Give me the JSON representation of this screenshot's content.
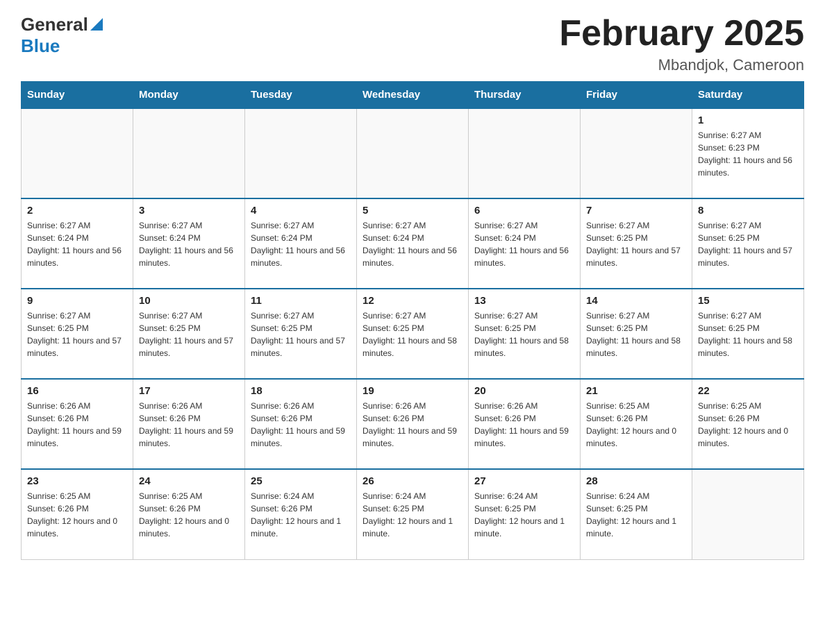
{
  "header": {
    "logo_general": "General",
    "logo_blue": "Blue",
    "month_title": "February 2025",
    "location": "Mbandjok, Cameroon"
  },
  "days_of_week": [
    "Sunday",
    "Monday",
    "Tuesday",
    "Wednesday",
    "Thursday",
    "Friday",
    "Saturday"
  ],
  "weeks": [
    [
      {
        "day": "",
        "sunrise": "",
        "sunset": "",
        "daylight": ""
      },
      {
        "day": "",
        "sunrise": "",
        "sunset": "",
        "daylight": ""
      },
      {
        "day": "",
        "sunrise": "",
        "sunset": "",
        "daylight": ""
      },
      {
        "day": "",
        "sunrise": "",
        "sunset": "",
        "daylight": ""
      },
      {
        "day": "",
        "sunrise": "",
        "sunset": "",
        "daylight": ""
      },
      {
        "day": "",
        "sunrise": "",
        "sunset": "",
        "daylight": ""
      },
      {
        "day": "1",
        "sunrise": "Sunrise: 6:27 AM",
        "sunset": "Sunset: 6:23 PM",
        "daylight": "Daylight: 11 hours and 56 minutes."
      }
    ],
    [
      {
        "day": "2",
        "sunrise": "Sunrise: 6:27 AM",
        "sunset": "Sunset: 6:24 PM",
        "daylight": "Daylight: 11 hours and 56 minutes."
      },
      {
        "day": "3",
        "sunrise": "Sunrise: 6:27 AM",
        "sunset": "Sunset: 6:24 PM",
        "daylight": "Daylight: 11 hours and 56 minutes."
      },
      {
        "day": "4",
        "sunrise": "Sunrise: 6:27 AM",
        "sunset": "Sunset: 6:24 PM",
        "daylight": "Daylight: 11 hours and 56 minutes."
      },
      {
        "day": "5",
        "sunrise": "Sunrise: 6:27 AM",
        "sunset": "Sunset: 6:24 PM",
        "daylight": "Daylight: 11 hours and 56 minutes."
      },
      {
        "day": "6",
        "sunrise": "Sunrise: 6:27 AM",
        "sunset": "Sunset: 6:24 PM",
        "daylight": "Daylight: 11 hours and 56 minutes."
      },
      {
        "day": "7",
        "sunrise": "Sunrise: 6:27 AM",
        "sunset": "Sunset: 6:25 PM",
        "daylight": "Daylight: 11 hours and 57 minutes."
      },
      {
        "day": "8",
        "sunrise": "Sunrise: 6:27 AM",
        "sunset": "Sunset: 6:25 PM",
        "daylight": "Daylight: 11 hours and 57 minutes."
      }
    ],
    [
      {
        "day": "9",
        "sunrise": "Sunrise: 6:27 AM",
        "sunset": "Sunset: 6:25 PM",
        "daylight": "Daylight: 11 hours and 57 minutes."
      },
      {
        "day": "10",
        "sunrise": "Sunrise: 6:27 AM",
        "sunset": "Sunset: 6:25 PM",
        "daylight": "Daylight: 11 hours and 57 minutes."
      },
      {
        "day": "11",
        "sunrise": "Sunrise: 6:27 AM",
        "sunset": "Sunset: 6:25 PM",
        "daylight": "Daylight: 11 hours and 57 minutes."
      },
      {
        "day": "12",
        "sunrise": "Sunrise: 6:27 AM",
        "sunset": "Sunset: 6:25 PM",
        "daylight": "Daylight: 11 hours and 58 minutes."
      },
      {
        "day": "13",
        "sunrise": "Sunrise: 6:27 AM",
        "sunset": "Sunset: 6:25 PM",
        "daylight": "Daylight: 11 hours and 58 minutes."
      },
      {
        "day": "14",
        "sunrise": "Sunrise: 6:27 AM",
        "sunset": "Sunset: 6:25 PM",
        "daylight": "Daylight: 11 hours and 58 minutes."
      },
      {
        "day": "15",
        "sunrise": "Sunrise: 6:27 AM",
        "sunset": "Sunset: 6:25 PM",
        "daylight": "Daylight: 11 hours and 58 minutes."
      }
    ],
    [
      {
        "day": "16",
        "sunrise": "Sunrise: 6:26 AM",
        "sunset": "Sunset: 6:26 PM",
        "daylight": "Daylight: 11 hours and 59 minutes."
      },
      {
        "day": "17",
        "sunrise": "Sunrise: 6:26 AM",
        "sunset": "Sunset: 6:26 PM",
        "daylight": "Daylight: 11 hours and 59 minutes."
      },
      {
        "day": "18",
        "sunrise": "Sunrise: 6:26 AM",
        "sunset": "Sunset: 6:26 PM",
        "daylight": "Daylight: 11 hours and 59 minutes."
      },
      {
        "day": "19",
        "sunrise": "Sunrise: 6:26 AM",
        "sunset": "Sunset: 6:26 PM",
        "daylight": "Daylight: 11 hours and 59 minutes."
      },
      {
        "day": "20",
        "sunrise": "Sunrise: 6:26 AM",
        "sunset": "Sunset: 6:26 PM",
        "daylight": "Daylight: 11 hours and 59 minutes."
      },
      {
        "day": "21",
        "sunrise": "Sunrise: 6:25 AM",
        "sunset": "Sunset: 6:26 PM",
        "daylight": "Daylight: 12 hours and 0 minutes."
      },
      {
        "day": "22",
        "sunrise": "Sunrise: 6:25 AM",
        "sunset": "Sunset: 6:26 PM",
        "daylight": "Daylight: 12 hours and 0 minutes."
      }
    ],
    [
      {
        "day": "23",
        "sunrise": "Sunrise: 6:25 AM",
        "sunset": "Sunset: 6:26 PM",
        "daylight": "Daylight: 12 hours and 0 minutes."
      },
      {
        "day": "24",
        "sunrise": "Sunrise: 6:25 AM",
        "sunset": "Sunset: 6:26 PM",
        "daylight": "Daylight: 12 hours and 0 minutes."
      },
      {
        "day": "25",
        "sunrise": "Sunrise: 6:24 AM",
        "sunset": "Sunset: 6:26 PM",
        "daylight": "Daylight: 12 hours and 1 minute."
      },
      {
        "day": "26",
        "sunrise": "Sunrise: 6:24 AM",
        "sunset": "Sunset: 6:25 PM",
        "daylight": "Daylight: 12 hours and 1 minute."
      },
      {
        "day": "27",
        "sunrise": "Sunrise: 6:24 AM",
        "sunset": "Sunset: 6:25 PM",
        "daylight": "Daylight: 12 hours and 1 minute."
      },
      {
        "day": "28",
        "sunrise": "Sunrise: 6:24 AM",
        "sunset": "Sunset: 6:25 PM",
        "daylight": "Daylight: 12 hours and 1 minute."
      },
      {
        "day": "",
        "sunrise": "",
        "sunset": "",
        "daylight": ""
      }
    ]
  ]
}
